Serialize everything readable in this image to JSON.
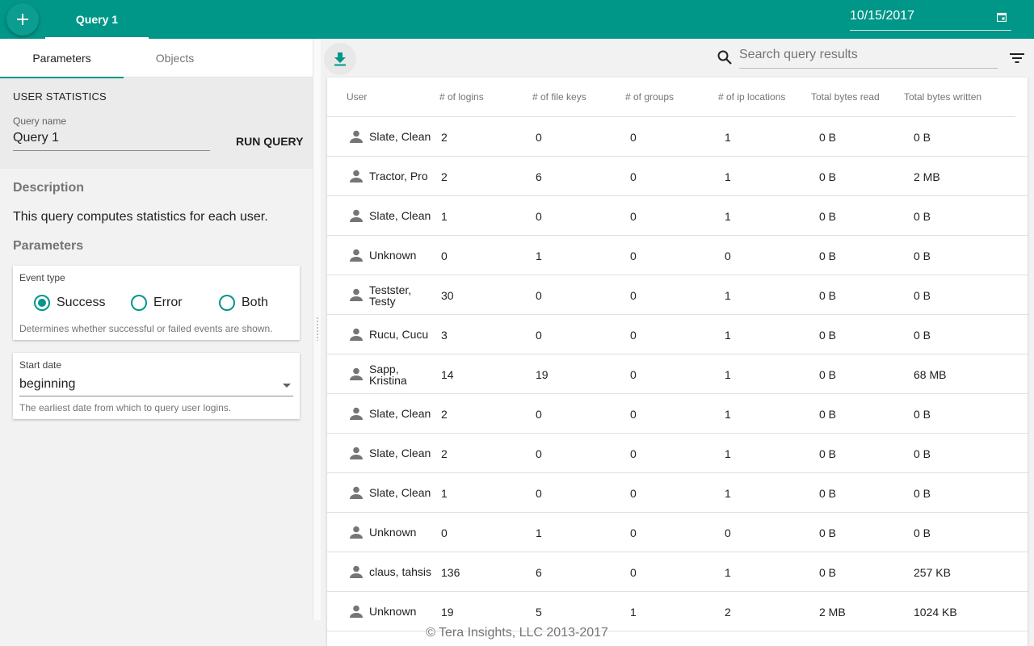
{
  "topbar": {
    "add_icon": "plus-icon",
    "active_tab": "Query 1",
    "date_value": "10/15/2017",
    "date_icon": "calendar-icon",
    "color": "#009688"
  },
  "left_panel": {
    "tabs": [
      {
        "label": "Parameters",
        "active": true
      },
      {
        "label": "Objects",
        "active": false
      }
    ],
    "section_title": "USER STATISTICS",
    "query_name_label": "Query name",
    "query_name_value": "Query 1",
    "run_button": "RUN QUERY",
    "description_heading": "Description",
    "description_text": "This query computes statistics for each user.",
    "parameters_heading": "Parameters",
    "event_type": {
      "label": "Event type",
      "options": [
        "Success",
        "Error",
        "Both"
      ],
      "selected": "Success",
      "help": "Determines whether successful or failed events are shown."
    },
    "start_date": {
      "label": "Start date",
      "value": "beginning",
      "help": "The earliest date from which to query user logins."
    }
  },
  "results": {
    "download_icon": "download-icon",
    "search_icon": "search-icon",
    "search_placeholder": "Search query results",
    "filter_icon": "filter-icon",
    "columns": [
      "User",
      "# of logins",
      "# of file keys",
      "# of groups",
      "# of ip locations",
      "Total bytes read",
      "Total bytes written"
    ],
    "rows": [
      {
        "user": "Slate, Clean",
        "logins": "2",
        "file_keys": "0",
        "groups": "0",
        "ip_locations": "1",
        "bytes_read": "0 B",
        "bytes_written": "0 B"
      },
      {
        "user": "Tractor, Pro",
        "logins": "2",
        "file_keys": "6",
        "groups": "0",
        "ip_locations": "1",
        "bytes_read": "0 B",
        "bytes_written": "2 MB"
      },
      {
        "user": "Slate, Clean",
        "logins": "1",
        "file_keys": "0",
        "groups": "0",
        "ip_locations": "1",
        "bytes_read": "0 B",
        "bytes_written": "0 B"
      },
      {
        "user": "Unknown",
        "logins": "0",
        "file_keys": "1",
        "groups": "0",
        "ip_locations": "0",
        "bytes_read": "0 B",
        "bytes_written": "0 B"
      },
      {
        "user": "Testster, Testy",
        "logins": "30",
        "file_keys": "0",
        "groups": "0",
        "ip_locations": "1",
        "bytes_read": "0 B",
        "bytes_written": "0 B"
      },
      {
        "user": "Rucu, Cucu",
        "logins": "3",
        "file_keys": "0",
        "groups": "0",
        "ip_locations": "1",
        "bytes_read": "0 B",
        "bytes_written": "0 B"
      },
      {
        "user": "Sapp, Kristina",
        "logins": "14",
        "file_keys": "19",
        "groups": "0",
        "ip_locations": "1",
        "bytes_read": "0 B",
        "bytes_written": "68 MB"
      },
      {
        "user": "Slate, Clean",
        "logins": "2",
        "file_keys": "0",
        "groups": "0",
        "ip_locations": "1",
        "bytes_read": "0 B",
        "bytes_written": "0 B"
      },
      {
        "user": "Slate, Clean",
        "logins": "2",
        "file_keys": "0",
        "groups": "0",
        "ip_locations": "1",
        "bytes_read": "0 B",
        "bytes_written": "0 B"
      },
      {
        "user": "Slate, Clean",
        "logins": "1",
        "file_keys": "0",
        "groups": "0",
        "ip_locations": "1",
        "bytes_read": "0 B",
        "bytes_written": "0 B"
      },
      {
        "user": "Unknown",
        "logins": "0",
        "file_keys": "1",
        "groups": "0",
        "ip_locations": "0",
        "bytes_read": "0 B",
        "bytes_written": "0 B"
      },
      {
        "user": "claus, tahsis",
        "logins": "136",
        "file_keys": "6",
        "groups": "0",
        "ip_locations": "1",
        "bytes_read": "0 B",
        "bytes_written": "257 KB"
      },
      {
        "user": "Unknown",
        "logins": "19",
        "file_keys": "5",
        "groups": "1",
        "ip_locations": "2",
        "bytes_read": "2 MB",
        "bytes_written": "1024 KB"
      }
    ]
  },
  "footer": "© Tera Insights, LLC 2013-2017"
}
